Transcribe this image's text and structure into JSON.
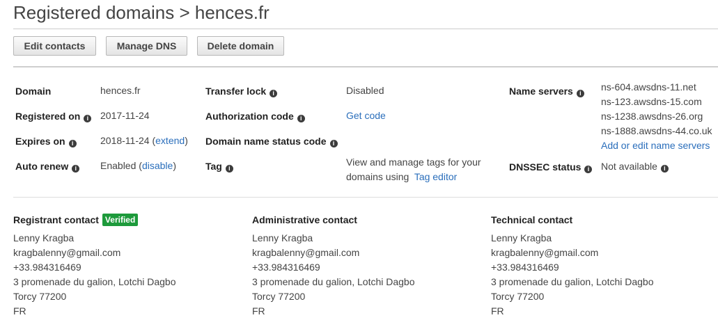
{
  "header": {
    "title": "Registered domains > hences.fr"
  },
  "toolbar": {
    "edit_contacts": "Edit contacts",
    "manage_dns": "Manage DNS",
    "delete_domain": "Delete domain"
  },
  "details": {
    "domain_label": "Domain",
    "domain_value": "hences.fr",
    "registered_label": "Registered on",
    "registered_value": "2017-11-24",
    "expires_label": "Expires on",
    "expires_value": "2018-11-24",
    "extend_link": "extend",
    "auto_renew_label": "Auto renew",
    "auto_renew_value": "Enabled",
    "disable_link": "disable",
    "transfer_lock_label": "Transfer lock",
    "transfer_lock_value": "Disabled",
    "auth_code_label": "Authorization code",
    "auth_code_link": "Get code",
    "status_code_label": "Domain name status code",
    "tag_label": "Tag",
    "tag_text_1": "View and manage tags for your",
    "tag_text_2": "domains using",
    "tag_editor_link": "Tag editor",
    "name_servers_label": "Name servers",
    "name_servers": [
      "ns-604.awsdns-11.net",
      "ns-123.awsdns-15.com",
      "ns-1238.awsdns-26.org",
      "ns-1888.awsdns-44.co.uk"
    ],
    "edit_name_servers_link": "Add or edit name servers",
    "dnssec_label": "DNSSEC status",
    "dnssec_value": "Not available"
  },
  "contacts": {
    "registrant": {
      "heading": "Registrant contact",
      "badge": "Verified",
      "lines": [
        "Lenny Kragba",
        "kragbalenny@gmail.com",
        "+33.984316469",
        "3 promenade du galion, Lotchi Dagbo",
        "Torcy 77200",
        "FR"
      ]
    },
    "administrative": {
      "heading": "Administrative contact",
      "lines": [
        "Lenny Kragba",
        "kragbalenny@gmail.com",
        "+33.984316469",
        "3 promenade du galion, Lotchi Dagbo",
        "Torcy 77200",
        "FR"
      ]
    },
    "technical": {
      "heading": "Technical contact",
      "lines": [
        "Lenny Kragba",
        "kragbalenny@gmail.com",
        "+33.984316469",
        "3 promenade du galion, Lotchi Dagbo",
        "Torcy 77200",
        "FR"
      ]
    }
  },
  "colors": {
    "link": "#2a6ebb",
    "verified_badge": "#1d9a3b"
  },
  "icons": {
    "info": "info-icon"
  }
}
